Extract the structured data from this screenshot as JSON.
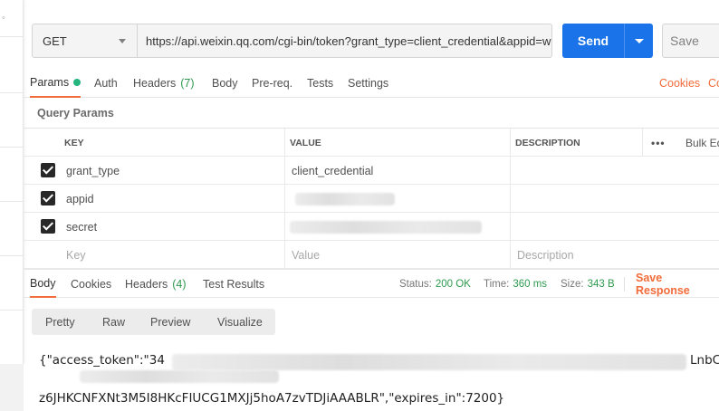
{
  "request": {
    "method": "GET",
    "url": "https://api.weixin.qq.com/cgi-bin/token?grant_type=client_credential&appid=w",
    "send_label": "Send",
    "save_label": "Save"
  },
  "request_tabs": [
    {
      "label": "Params"
    },
    {
      "label": "Auth"
    },
    {
      "label": "Headers",
      "count": "(7)"
    },
    {
      "label": "Body"
    },
    {
      "label": "Pre-req."
    },
    {
      "label": "Tests"
    },
    {
      "label": "Settings"
    }
  ],
  "right_links": {
    "cookies": "Cookies",
    "code": "Co"
  },
  "query_params": {
    "title": "Query Params",
    "columns": {
      "key": "KEY",
      "value": "VALUE",
      "description": "DESCRIPTION",
      "more": "•••",
      "bulk_edit": "Bulk Ed"
    },
    "rows": [
      {
        "key": "grant_type",
        "value": "client_credential",
        "checked": true
      },
      {
        "key": "appid",
        "value": "",
        "checked": true
      },
      {
        "key": "secret",
        "value": "",
        "checked": true
      }
    ],
    "placeholders": {
      "key": "Key",
      "value": "Value",
      "description": "Description"
    }
  },
  "response": {
    "tabs": [
      {
        "label": "Body"
      },
      {
        "label": "Cookies"
      },
      {
        "label": "Headers",
        "count": "(4)"
      },
      {
        "label": "Test Results"
      }
    ],
    "status_label": "Status:",
    "status_value": "200 OK",
    "time_label": "Time:",
    "time_value": "360 ms",
    "size_label": "Size:",
    "size_value": "343 B",
    "save_response": "Save Response",
    "view_modes": [
      "Pretty",
      "Raw",
      "Preview",
      "Visualize"
    ],
    "body_line1_start": "{\"access_token\":\"34",
    "body_line1_end": "LnbC",
    "body_line2": "z6JHKCNFXNt3M5I8HKcFIUCG1MXJj5hoA7zvTDJiAAABLR\",\"expires_in\":7200}"
  },
  "colors": {
    "accent_orange": "#f26b3a",
    "send_blue": "#1a73e8",
    "status_green": "#2e9a4f"
  }
}
